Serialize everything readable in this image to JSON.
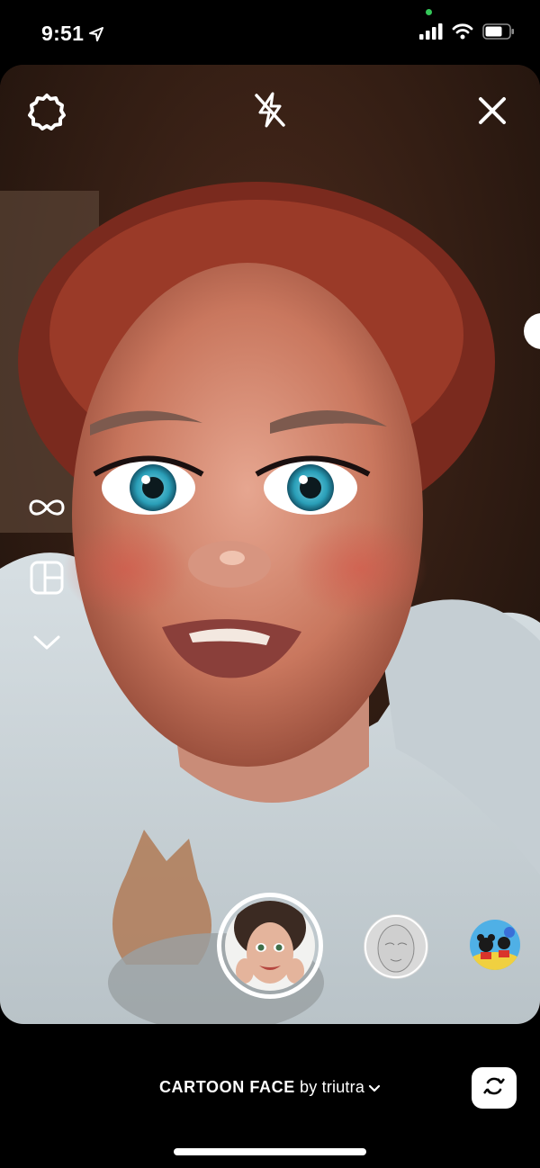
{
  "status_bar": {
    "time": "9:51",
    "icons": [
      "location-arrow-icon",
      "signal-bars-icon",
      "wifi-icon",
      "battery-icon"
    ]
  },
  "camera": {
    "top_controls": [
      "settings-gear-icon",
      "flash-off-icon",
      "close-icon"
    ],
    "side_tools": [
      "boomerang-infinity-icon",
      "layout-grid-icon",
      "chevron-down-icon"
    ],
    "effects": [
      {
        "name": "cartoon-face-effect",
        "selected": true
      },
      {
        "name": "sketch-face-effect",
        "selected": false
      },
      {
        "name": "cartoon-characters-effect",
        "selected": false
      }
    ]
  },
  "effect_label": {
    "name": "CARTOON FACE",
    "by": " by triutra"
  },
  "colors": {
    "background": "#000000",
    "accent": "#ffffff",
    "camera_indicator": "#34c759"
  }
}
